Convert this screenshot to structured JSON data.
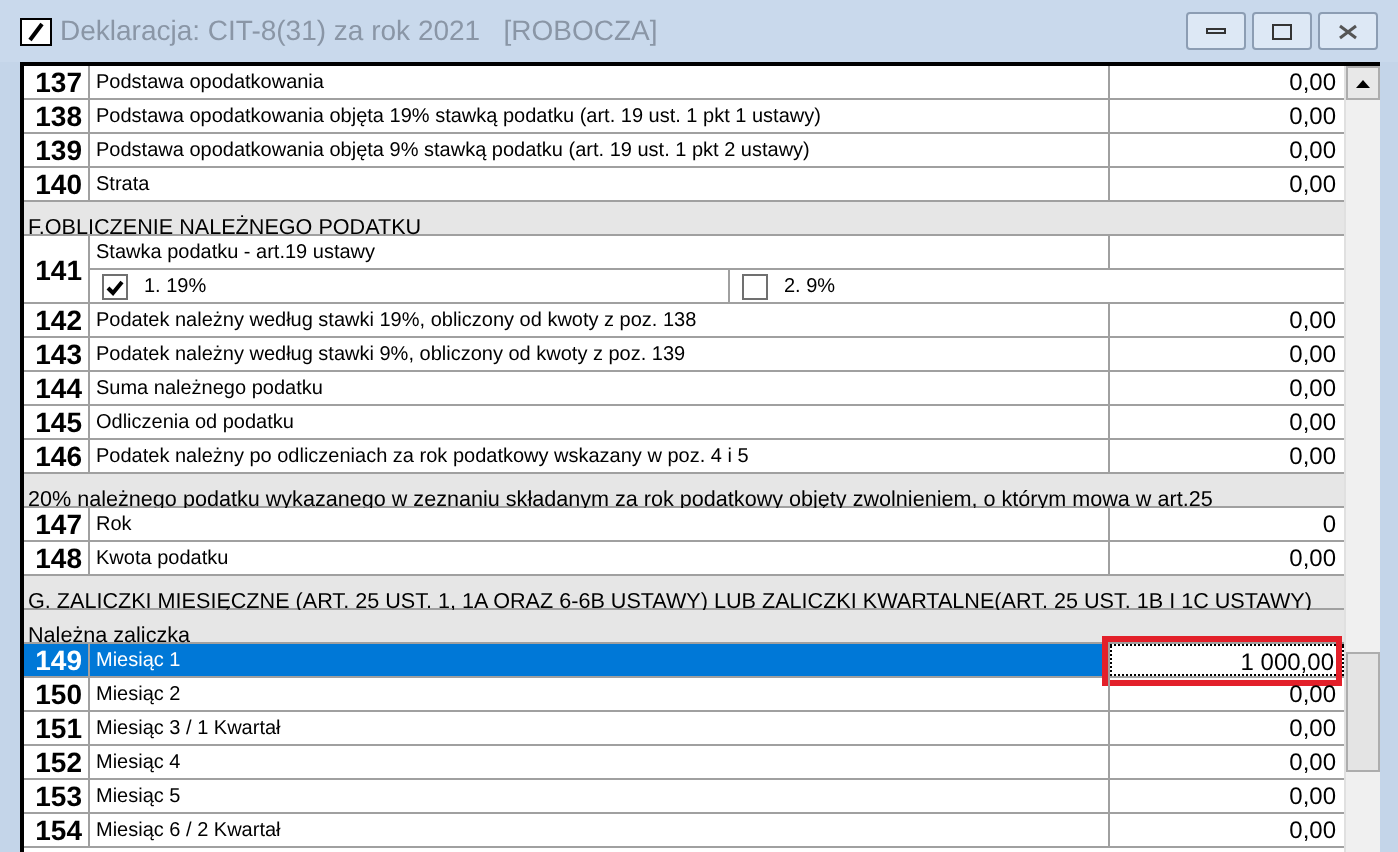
{
  "window": {
    "title": "Deklaracja: CIT-8(31) za rok 2021   [ROBOCZA]"
  },
  "rows": [
    {
      "kind": "item",
      "number": "137",
      "label": "Podstawa opodatkowania",
      "value": "0,00",
      "selected": false
    },
    {
      "kind": "item",
      "number": "138",
      "label": "Podstawa opodatkowania objęta 19% stawką podatku (art. 19 ust. 1 pkt 1 ustawy)",
      "value": "0,00",
      "selected": false
    },
    {
      "kind": "item",
      "number": "139",
      "label": "Podstawa opodatkowania objęta 9% stawką podatku (art. 19 ust. 1 pkt 2 ustawy)",
      "value": "0,00",
      "selected": false
    },
    {
      "kind": "item",
      "number": "140",
      "label": "Strata",
      "value": "0,00",
      "selected": false
    },
    {
      "kind": "section",
      "label": "F.OBLICZENIE NALEŻNEGO PODATKU"
    },
    {
      "kind": "rate",
      "number": "141",
      "label": "Stawka podatku - art.19 ustawy",
      "selected": false,
      "options": [
        {
          "label": "1. 19%",
          "checked": true
        },
        {
          "label": "2. 9%",
          "checked": false
        }
      ]
    },
    {
      "kind": "item",
      "number": "142",
      "label": "Podatek należny według stawki 19%, obliczony od kwoty z poz. 138",
      "value": "0,00",
      "selected": false
    },
    {
      "kind": "item",
      "number": "143",
      "label": "Podatek należny według stawki 9%, obliczony od kwoty z poz. 139",
      "value": "0,00",
      "selected": false
    },
    {
      "kind": "item",
      "number": "144",
      "label": "Suma należnego podatku",
      "value": "0,00",
      "selected": false
    },
    {
      "kind": "item",
      "number": "145",
      "label": "Odliczenia od podatku",
      "value": "0,00",
      "selected": false
    },
    {
      "kind": "item",
      "number": "146",
      "label": "Podatek należny po odliczeniach za rok podatkowy wskazany w poz. 4 i 5",
      "value": "0,00",
      "selected": false
    },
    {
      "kind": "section",
      "label": "20% należnego podatku wykazanego w zeznaniu składanym za rok podatkowy objęty zwolnieniem, o którym mowa w art.25"
    },
    {
      "kind": "item",
      "number": "147",
      "label": "Rok",
      "value": "0",
      "selected": false
    },
    {
      "kind": "item",
      "number": "148",
      "label": "Kwota podatku",
      "value": "0,00",
      "selected": false
    },
    {
      "kind": "section",
      "label": "G. ZALICZKI MIESIĘCZNE (ART. 25 UST. 1, 1A ORAZ 6-6B USTAWY) LUB ZALICZKI KWARTALNE(ART. 25 UST. 1B I 1C USTAWY)"
    },
    {
      "kind": "section",
      "label": "Należna zaliczka"
    },
    {
      "kind": "item",
      "number": "149",
      "label": "Miesiąc 1",
      "value": "1 000,00",
      "selected": true,
      "highlighted": true
    },
    {
      "kind": "item",
      "number": "150",
      "label": "Miesiąc 2",
      "value": "0,00",
      "selected": false
    },
    {
      "kind": "item",
      "number": "151",
      "label": "Miesiąc 3 / 1 Kwartał",
      "value": "0,00",
      "selected": false
    },
    {
      "kind": "item",
      "number": "152",
      "label": "Miesiąc 4",
      "value": "0,00",
      "selected": false
    },
    {
      "kind": "item",
      "number": "153",
      "label": "Miesiąc 5",
      "value": "0,00",
      "selected": false
    },
    {
      "kind": "item",
      "number": "154",
      "label": "Miesiąc 6 / 2 Kwartał",
      "value": "0,00",
      "selected": false
    }
  ]
}
